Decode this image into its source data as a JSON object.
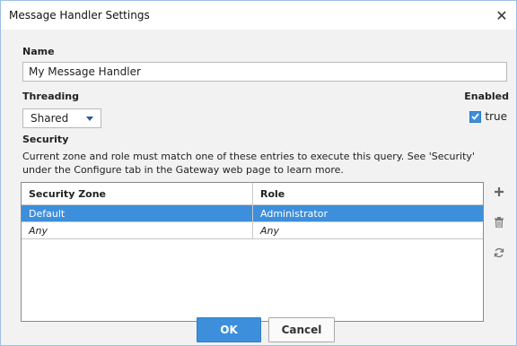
{
  "window": {
    "title": "Message Handler Settings",
    "close_icon": "close-icon"
  },
  "form": {
    "name_label": "Name",
    "name_value": "My Message Handler",
    "threading_label": "Threading",
    "threading_value": "Shared",
    "enabled_label": "Enabled",
    "enabled_checked": true,
    "enabled_value_label": "true",
    "security_label": "Security",
    "security_description": "Current zone and role must match one of these entries to execute this query. See 'Security' under the Configure tab in the Gateway web page to learn more."
  },
  "table": {
    "headers": [
      "Security Zone",
      "Role"
    ],
    "rows": [
      {
        "zone": "Default",
        "role": "Administrator",
        "selected": true
      },
      {
        "zone": "Any",
        "role": "Any",
        "selected": false
      }
    ]
  },
  "side_icons": [
    "add-icon",
    "trash-icon",
    "refresh-icon"
  ],
  "buttons": {
    "ok": "OK",
    "cancel": "Cancel"
  },
  "colors": {
    "accent": "#3d8fdc",
    "border": "#9dbfe6"
  }
}
